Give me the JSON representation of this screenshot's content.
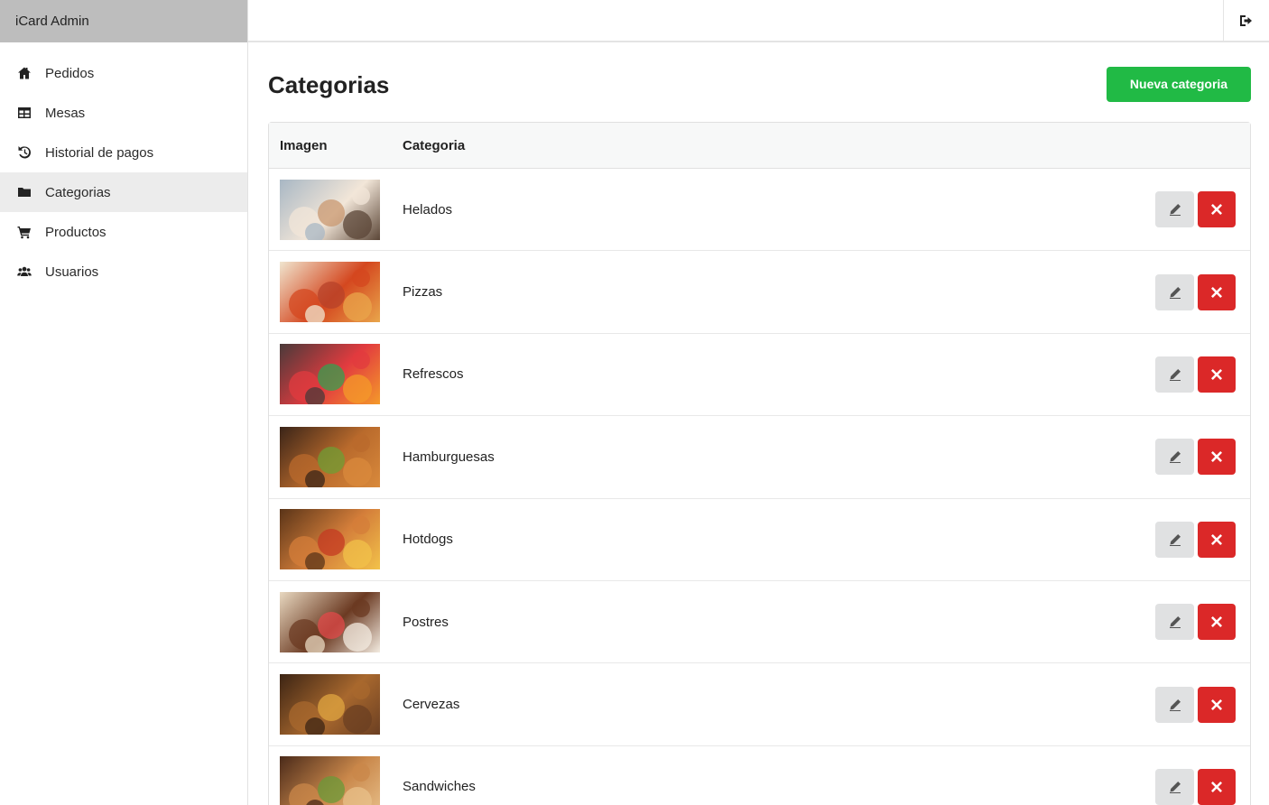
{
  "app": {
    "brand": "iCard Admin"
  },
  "sidebar": {
    "items": [
      {
        "label": "Pedidos",
        "icon": "home-icon",
        "active": false
      },
      {
        "label": "Mesas",
        "icon": "table-icon",
        "active": false
      },
      {
        "label": "Historial de pagos",
        "icon": "history-icon",
        "active": false
      },
      {
        "label": "Categorias",
        "icon": "folder-icon",
        "active": true
      },
      {
        "label": "Productos",
        "icon": "cart-icon",
        "active": false
      },
      {
        "label": "Usuarios",
        "icon": "users-icon",
        "active": false
      }
    ]
  },
  "topbar": {
    "logout_icon": "sign-out-icon"
  },
  "page": {
    "title": "Categorias",
    "new_button": "Nueva categoria"
  },
  "table": {
    "columns": [
      "Imagen",
      "Categoria"
    ],
    "rows": [
      {
        "name": "Helados",
        "colors": [
          "#a8b7c4",
          "#f2e6d8",
          "#c99870",
          "#5b4637"
        ]
      },
      {
        "name": "Pizzas",
        "colors": [
          "#f0e5cf",
          "#d4471f",
          "#b7412a",
          "#e9a64b"
        ]
      },
      {
        "name": "Refrescos",
        "colors": [
          "#4a3a3a",
          "#e23b3f",
          "#35a04f",
          "#f49a2a"
        ]
      },
      {
        "name": "Hamburguesas",
        "colors": [
          "#3a2418",
          "#b96a2c",
          "#6f9d34",
          "#d98a3c"
        ]
      },
      {
        "name": "Hotdogs",
        "colors": [
          "#5a3418",
          "#d47e3a",
          "#c43a22",
          "#f2c24a"
        ]
      },
      {
        "name": "Postres",
        "colors": [
          "#e8d8c0",
          "#6b3a22",
          "#e24a4a",
          "#f3ebe0"
        ]
      },
      {
        "name": "Cervezas",
        "colors": [
          "#3c2414",
          "#a8682e",
          "#e0a640",
          "#6b3f22"
        ]
      },
      {
        "name": "Sandwiches",
        "colors": [
          "#4a2a1a",
          "#c9874a",
          "#6a9a38",
          "#e8c08a"
        ]
      }
    ],
    "edit_icon": "pencil-icon",
    "delete_icon": "close-icon"
  }
}
